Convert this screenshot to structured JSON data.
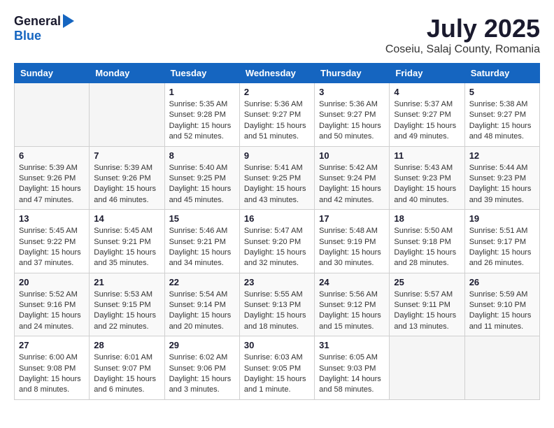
{
  "header": {
    "logo_general": "General",
    "logo_blue": "Blue",
    "month": "July 2025",
    "location": "Coseiu, Salaj County, Romania"
  },
  "weekdays": [
    "Sunday",
    "Monday",
    "Tuesday",
    "Wednesday",
    "Thursday",
    "Friday",
    "Saturday"
  ],
  "weeks": [
    [
      {
        "day": "",
        "sunrise": "",
        "sunset": "",
        "daylight": ""
      },
      {
        "day": "",
        "sunrise": "",
        "sunset": "",
        "daylight": ""
      },
      {
        "day": "1",
        "sunrise": "Sunrise: 5:35 AM",
        "sunset": "Sunset: 9:28 PM",
        "daylight": "Daylight: 15 hours and 52 minutes."
      },
      {
        "day": "2",
        "sunrise": "Sunrise: 5:36 AM",
        "sunset": "Sunset: 9:27 PM",
        "daylight": "Daylight: 15 hours and 51 minutes."
      },
      {
        "day": "3",
        "sunrise": "Sunrise: 5:36 AM",
        "sunset": "Sunset: 9:27 PM",
        "daylight": "Daylight: 15 hours and 50 minutes."
      },
      {
        "day": "4",
        "sunrise": "Sunrise: 5:37 AM",
        "sunset": "Sunset: 9:27 PM",
        "daylight": "Daylight: 15 hours and 49 minutes."
      },
      {
        "day": "5",
        "sunrise": "Sunrise: 5:38 AM",
        "sunset": "Sunset: 9:27 PM",
        "daylight": "Daylight: 15 hours and 48 minutes."
      }
    ],
    [
      {
        "day": "6",
        "sunrise": "Sunrise: 5:39 AM",
        "sunset": "Sunset: 9:26 PM",
        "daylight": "Daylight: 15 hours and 47 minutes."
      },
      {
        "day": "7",
        "sunrise": "Sunrise: 5:39 AM",
        "sunset": "Sunset: 9:26 PM",
        "daylight": "Daylight: 15 hours and 46 minutes."
      },
      {
        "day": "8",
        "sunrise": "Sunrise: 5:40 AM",
        "sunset": "Sunset: 9:25 PM",
        "daylight": "Daylight: 15 hours and 45 minutes."
      },
      {
        "day": "9",
        "sunrise": "Sunrise: 5:41 AM",
        "sunset": "Sunset: 9:25 PM",
        "daylight": "Daylight: 15 hours and 43 minutes."
      },
      {
        "day": "10",
        "sunrise": "Sunrise: 5:42 AM",
        "sunset": "Sunset: 9:24 PM",
        "daylight": "Daylight: 15 hours and 42 minutes."
      },
      {
        "day": "11",
        "sunrise": "Sunrise: 5:43 AM",
        "sunset": "Sunset: 9:23 PM",
        "daylight": "Daylight: 15 hours and 40 minutes."
      },
      {
        "day": "12",
        "sunrise": "Sunrise: 5:44 AM",
        "sunset": "Sunset: 9:23 PM",
        "daylight": "Daylight: 15 hours and 39 minutes."
      }
    ],
    [
      {
        "day": "13",
        "sunrise": "Sunrise: 5:45 AM",
        "sunset": "Sunset: 9:22 PM",
        "daylight": "Daylight: 15 hours and 37 minutes."
      },
      {
        "day": "14",
        "sunrise": "Sunrise: 5:45 AM",
        "sunset": "Sunset: 9:21 PM",
        "daylight": "Daylight: 15 hours and 35 minutes."
      },
      {
        "day": "15",
        "sunrise": "Sunrise: 5:46 AM",
        "sunset": "Sunset: 9:21 PM",
        "daylight": "Daylight: 15 hours and 34 minutes."
      },
      {
        "day": "16",
        "sunrise": "Sunrise: 5:47 AM",
        "sunset": "Sunset: 9:20 PM",
        "daylight": "Daylight: 15 hours and 32 minutes."
      },
      {
        "day": "17",
        "sunrise": "Sunrise: 5:48 AM",
        "sunset": "Sunset: 9:19 PM",
        "daylight": "Daylight: 15 hours and 30 minutes."
      },
      {
        "day": "18",
        "sunrise": "Sunrise: 5:50 AM",
        "sunset": "Sunset: 9:18 PM",
        "daylight": "Daylight: 15 hours and 28 minutes."
      },
      {
        "day": "19",
        "sunrise": "Sunrise: 5:51 AM",
        "sunset": "Sunset: 9:17 PM",
        "daylight": "Daylight: 15 hours and 26 minutes."
      }
    ],
    [
      {
        "day": "20",
        "sunrise": "Sunrise: 5:52 AM",
        "sunset": "Sunset: 9:16 PM",
        "daylight": "Daylight: 15 hours and 24 minutes."
      },
      {
        "day": "21",
        "sunrise": "Sunrise: 5:53 AM",
        "sunset": "Sunset: 9:15 PM",
        "daylight": "Daylight: 15 hours and 22 minutes."
      },
      {
        "day": "22",
        "sunrise": "Sunrise: 5:54 AM",
        "sunset": "Sunset: 9:14 PM",
        "daylight": "Daylight: 15 hours and 20 minutes."
      },
      {
        "day": "23",
        "sunrise": "Sunrise: 5:55 AM",
        "sunset": "Sunset: 9:13 PM",
        "daylight": "Daylight: 15 hours and 18 minutes."
      },
      {
        "day": "24",
        "sunrise": "Sunrise: 5:56 AM",
        "sunset": "Sunset: 9:12 PM",
        "daylight": "Daylight: 15 hours and 15 minutes."
      },
      {
        "day": "25",
        "sunrise": "Sunrise: 5:57 AM",
        "sunset": "Sunset: 9:11 PM",
        "daylight": "Daylight: 15 hours and 13 minutes."
      },
      {
        "day": "26",
        "sunrise": "Sunrise: 5:59 AM",
        "sunset": "Sunset: 9:10 PM",
        "daylight": "Daylight: 15 hours and 11 minutes."
      }
    ],
    [
      {
        "day": "27",
        "sunrise": "Sunrise: 6:00 AM",
        "sunset": "Sunset: 9:08 PM",
        "daylight": "Daylight: 15 hours and 8 minutes."
      },
      {
        "day": "28",
        "sunrise": "Sunrise: 6:01 AM",
        "sunset": "Sunset: 9:07 PM",
        "daylight": "Daylight: 15 hours and 6 minutes."
      },
      {
        "day": "29",
        "sunrise": "Sunrise: 6:02 AM",
        "sunset": "Sunset: 9:06 PM",
        "daylight": "Daylight: 15 hours and 3 minutes."
      },
      {
        "day": "30",
        "sunrise": "Sunrise: 6:03 AM",
        "sunset": "Sunset: 9:05 PM",
        "daylight": "Daylight: 15 hours and 1 minute."
      },
      {
        "day": "31",
        "sunrise": "Sunrise: 6:05 AM",
        "sunset": "Sunset: 9:03 PM",
        "daylight": "Daylight: 14 hours and 58 minutes."
      },
      {
        "day": "",
        "sunrise": "",
        "sunset": "",
        "daylight": ""
      },
      {
        "day": "",
        "sunrise": "",
        "sunset": "",
        "daylight": ""
      }
    ]
  ]
}
